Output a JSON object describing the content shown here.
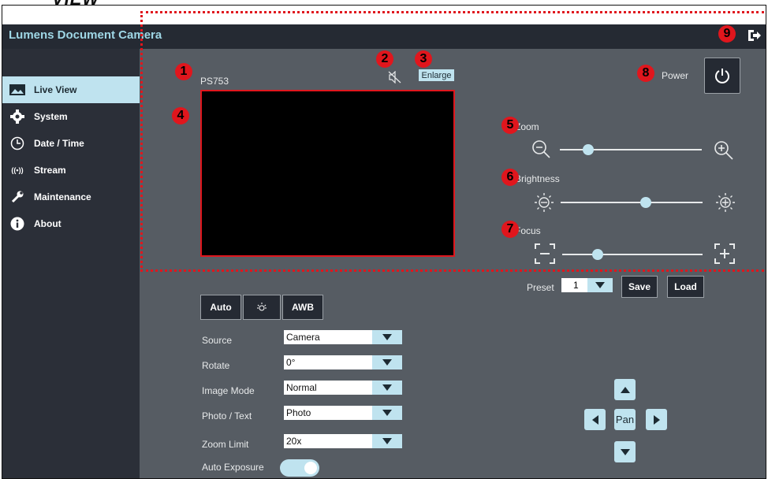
{
  "heading": "VIEW",
  "brand": {
    "title": "Lumens Document Camera"
  },
  "sidebar": {
    "items": [
      {
        "label": "Live View",
        "icon": "image-icon",
        "active": true
      },
      {
        "label": "System",
        "icon": "gear-icon"
      },
      {
        "label": "Date / Time",
        "icon": "clock-icon"
      },
      {
        "label": "Stream",
        "icon": "broadcast-icon"
      },
      {
        "label": "Maintenance",
        "icon": "wrench-icon"
      },
      {
        "label": "About",
        "icon": "info-icon"
      }
    ]
  },
  "live": {
    "device_name": "PS753",
    "enlarge_label": "Enlarge",
    "power_label": "Power",
    "zoom_label": "Zoom",
    "brightness_label": "Brightness",
    "focus_label": "Focus",
    "zoom_value": 0.2,
    "brightness_value": 0.6,
    "focus_value": 0.25
  },
  "callouts": [
    "1",
    "2",
    "3",
    "4",
    "5",
    "6",
    "7",
    "8",
    "9"
  ],
  "preset": {
    "label": "Preset",
    "value": "1",
    "save_label": "Save",
    "load_label": "Load"
  },
  "modes": {
    "auto_label": "Auto",
    "awb_label": "AWB"
  },
  "settings": [
    {
      "label": "Source",
      "value": "Camera"
    },
    {
      "label": "Rotate",
      "value": "0°"
    },
    {
      "label": "Image Mode",
      "value": "Normal"
    },
    {
      "label": "Photo / Text",
      "value": "Photo"
    },
    {
      "label": "Zoom Limit",
      "value": "20x"
    }
  ],
  "auto_exposure": {
    "label": "Auto Exposure",
    "on": true
  },
  "pan": {
    "label": "Pan"
  },
  "colors": {
    "accent": "#bfe3ef",
    "sidebar": "#2b2f38",
    "panel": "#565c63",
    "callout": "#e0161d"
  }
}
